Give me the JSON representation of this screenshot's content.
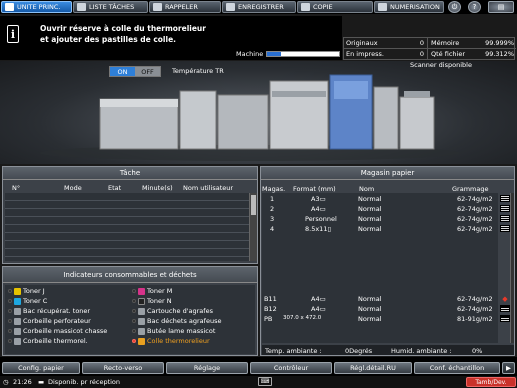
{
  "tabs": [
    {
      "label": "UNITE PRINC.",
      "active": true
    },
    {
      "label": "LISTE TÂCHES",
      "active": false
    },
    {
      "label": "RAPPELER",
      "active": false
    },
    {
      "label": "ENREGISTRER",
      "active": false
    },
    {
      "label": "COPIE",
      "active": false
    },
    {
      "label": "NUMERISATION",
      "active": false
    }
  ],
  "message": {
    "line1": "Ouvrir réserve à colle du thermorelieur",
    "line2": "et ajouter des pastilles de colle.",
    "machine_label": "Machine",
    "machine_progress": 0.2
  },
  "counters": {
    "originals_label": "Originaux",
    "originals_value": "0",
    "printing_label": "En impress.",
    "printing_value": "0",
    "memory_label": "Mémoire",
    "memory_value": "99.999%",
    "file_qty_label": "Qté fichier",
    "file_qty_value": "99.312%"
  },
  "tr": {
    "on_label": "ON",
    "off_label": "OFF",
    "label": "Température TR",
    "selected": "ON"
  },
  "scanner_status": "Scanner disponible",
  "task": {
    "title": "Tâche",
    "columns": [
      "N°",
      "Mode",
      "Etat",
      "Minute(s)",
      "Nom utilisateur"
    ]
  },
  "consumables": {
    "title": "Indicateurs consommables et déchets",
    "left": [
      {
        "label": "Toner J",
        "color": "#e6c200",
        "alert": false
      },
      {
        "label": "Toner C",
        "color": "#1ea7e0",
        "alert": false
      },
      {
        "label": "Bac récupérat. toner",
        "color": "#9aa0a6",
        "alert": false
      },
      {
        "label": "Corbeille perforateur",
        "color": "#9aa0a6",
        "alert": false
      },
      {
        "label": "Corbeille massicot chasse",
        "color": "#9aa0a6",
        "alert": false
      },
      {
        "label": "Corbeille thermorel.",
        "color": "#9aa0a6",
        "alert": false
      }
    ],
    "right": [
      {
        "label": "Toner M",
        "color": "#d6338a",
        "alert": false
      },
      {
        "label": "Toner N",
        "color": "#222222",
        "alert": false
      },
      {
        "label": "Cartouche d'agrafes",
        "color": "#9aa0a6",
        "alert": false
      },
      {
        "label": "Bac déchets agrafeuse",
        "color": "#9aa0a6",
        "alert": false
      },
      {
        "label": "Butée lame massicot",
        "color": "#9aa0a6",
        "alert": false
      },
      {
        "label": "Colle thermorelieur",
        "color": "#e8a020",
        "alert": true
      }
    ]
  },
  "paper": {
    "title": "Magasin papier",
    "columns": [
      "Magas.",
      "Format (mm)",
      "Nom",
      "Grammage"
    ],
    "rows": [
      {
        "tray": "1",
        "format": "A3▭",
        "name": "Normal",
        "weight": "62-74g/m2",
        "level": 4,
        "selected": false
      },
      {
        "tray": "2",
        "format": "A4▭",
        "name": "Normal",
        "weight": "62-74g/m2",
        "level": 4,
        "selected": false
      },
      {
        "tray": "3",
        "format": "Personnel",
        "name": "Normal",
        "weight": "62-74g/m2",
        "level": 4,
        "selected": false
      },
      {
        "tray": "4",
        "format": "8.5x11▯",
        "name": "Normal",
        "weight": "62-74g/m2",
        "level": 4,
        "selected": false
      }
    ],
    "rows_bottom": [
      {
        "tray": "B11",
        "format": "A4▭",
        "name": "Normal",
        "weight": "62-74g/m2",
        "level": 0,
        "selected": false
      },
      {
        "tray": "B12",
        "format": "A4▭",
        "name": "Normal",
        "weight": "62-74g/m2",
        "level": 3,
        "selected": false
      },
      {
        "tray": "PB",
        "format": "307.0 x 472.0",
        "name": "Normal",
        "weight": "81-91g/m2",
        "level": 3,
        "selected": false
      }
    ],
    "temp_label": "Temp. ambiante :",
    "temp_value": "0Degrés",
    "humid_label": "Humid. ambiante :",
    "humid_value": "0%"
  },
  "footer_buttons": [
    {
      "label": "Config. papier"
    },
    {
      "label": "Recto-verso"
    },
    {
      "label": "Réglage"
    },
    {
      "label": "Contrôleur"
    },
    {
      "label": "Régl.détail.RU"
    },
    {
      "label": "Conf. échantillon"
    }
  ],
  "status": {
    "time": "21:26",
    "message": "Disponib. pr réception",
    "tamb_button": "Tamb/Dev."
  }
}
